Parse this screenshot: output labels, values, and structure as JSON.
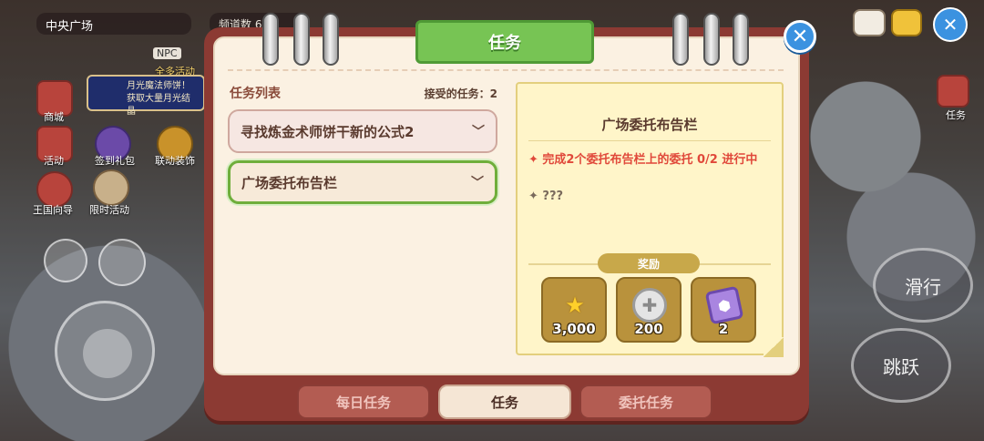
{
  "hud": {
    "location": "中央广场",
    "channel": "频道数 6",
    "npc_badge": "NPC",
    "banner_top": "全多活动",
    "banner_line1": "月光魔法师饼！",
    "banner_line2": "获取大量月光结晶",
    "left_buttons": [
      "商城",
      "活动",
      "签到礼包",
      "联动装饰",
      "王国向导",
      "限时活动"
    ],
    "right_label_quest": "任务",
    "slide_button": "滑行",
    "jump_button": "跳跃"
  },
  "panel": {
    "title": "任务",
    "close_symbol": "✕",
    "list_title": "任务列表",
    "accepted_label": "接受的任务：",
    "accepted_count": "2",
    "quests": [
      {
        "label": "寻找炼金术师饼干新的公式2",
        "selected": false
      },
      {
        "label": "广场委托布告栏",
        "selected": true
      }
    ],
    "detail": {
      "title": "广场委托布告栏",
      "objective": "✦ 完成2个委托布告栏上的委托 0/2 进行中",
      "hidden_objective": "✦ ???",
      "reward_label": "奖励",
      "rewards": [
        {
          "icon": "star-crown-icon",
          "qty": "3,000"
        },
        {
          "icon": "silver-coin-icon",
          "qty": "200"
        },
        {
          "icon": "purple-gem-book-icon",
          "qty": "2"
        }
      ]
    },
    "tabs": [
      {
        "label": "每日任务",
        "active": false
      },
      {
        "label": "任务",
        "active": true
      },
      {
        "label": "委托任务",
        "active": false
      }
    ]
  },
  "colors": {
    "panel_frame": "#8c3a33",
    "title_green": "#77c454",
    "selected_border": "#6fae3b",
    "objective_red": "#e0483a",
    "close_blue": "#3b92e0"
  }
}
